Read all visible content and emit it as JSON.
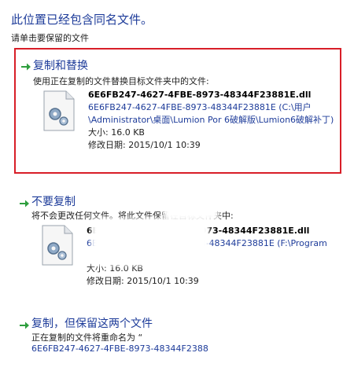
{
  "dialog": {
    "title": "此位置已经包含同名文件。",
    "subtitle": "请单击要保留的文件"
  },
  "options": {
    "copy_replace": {
      "heading": "复制和替换",
      "description": "使用正在复制的文件替换目标文件夹中的文件:",
      "file_name": "6E6FB247-4627-4FBE-8973-48344F23881E.dll",
      "file_path": "6E6FB247-4627-4FBE-8973-48344F23881E (C:\\用户\\Administrator\\桌面\\Lumion Por 6破解版\\Lumion6破解补丁)",
      "size": "大小: 16.0 KB",
      "modified": "修改日期: 2015/10/1 10:39"
    },
    "skip": {
      "heading": "不要复制",
      "description": "将不会更改任何文件。将此文件保留在目标文件夹中:",
      "file_name": "6E6FB247-4627-4FBE-8973-48344F23881E.dll",
      "file_path": "6E6FB247-4627-4FBE-8973-48344F23881E (F:\\Program",
      "size": "大小: 16.0 KB",
      "modified": "修改日期: 2015/10/1 10:39"
    },
    "keep_both": {
      "heading": "复制，但保留这两个文件",
      "description": "正在复制的文件将重命名为 “",
      "new_name": "6E6FB247-4627-4FBE-8973-48344F2388"
    }
  },
  "colors": {
    "link_blue": "#1e3c9a",
    "highlight_red": "#d81e28",
    "arrow_green": "#2e9e3e"
  },
  "icons": {
    "option_arrow": "green-arrow-icon",
    "file": "dll-file-gear-icon"
  }
}
